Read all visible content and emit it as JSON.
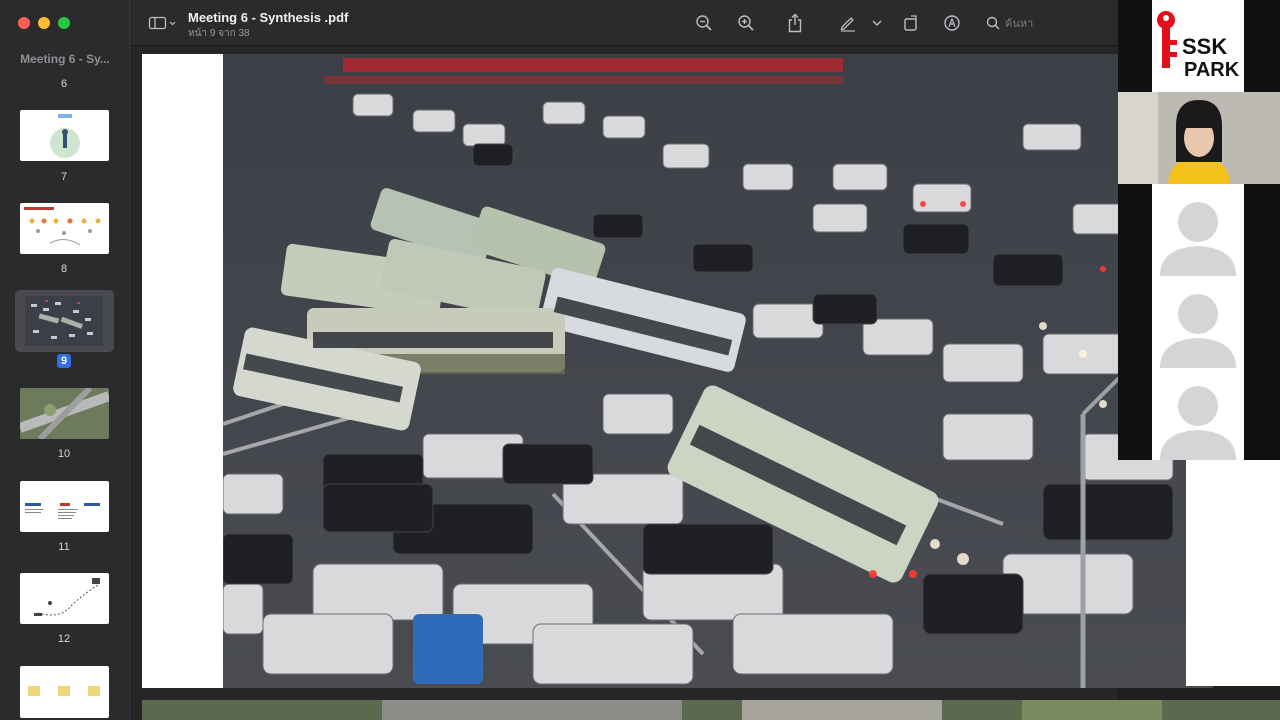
{
  "window": {
    "title": "Meeting 6 - Synthesis .pdf",
    "subtitle": "หน้า 9 จาก 38"
  },
  "sidebar": {
    "title": "Meeting 6 - Sy...",
    "pages": [
      "6",
      "7",
      "8",
      "9",
      "10",
      "11",
      "12"
    ],
    "active_page": "9"
  },
  "toolbar": {
    "search_placeholder": "ค้นหา",
    "icons": [
      "sidebar-toggle-icon",
      "zoom-out-icon",
      "zoom-in-icon",
      "share-icon",
      "markup-pen-icon",
      "chevron-down-icon",
      "rotate-icon",
      "markup-circle-icon",
      "search-icon"
    ]
  },
  "video": {
    "logo_line1": "SSK",
    "logo_line2": "PARK",
    "participants": [
      "speaker",
      "participant",
      "participant",
      "participant"
    ]
  },
  "colors": {
    "accent": "#2f6fde",
    "logo_red": "#e3101c",
    "window_close": "#ff5f57",
    "window_minimize": "#febc2e",
    "window_zoom": "#28c840"
  }
}
